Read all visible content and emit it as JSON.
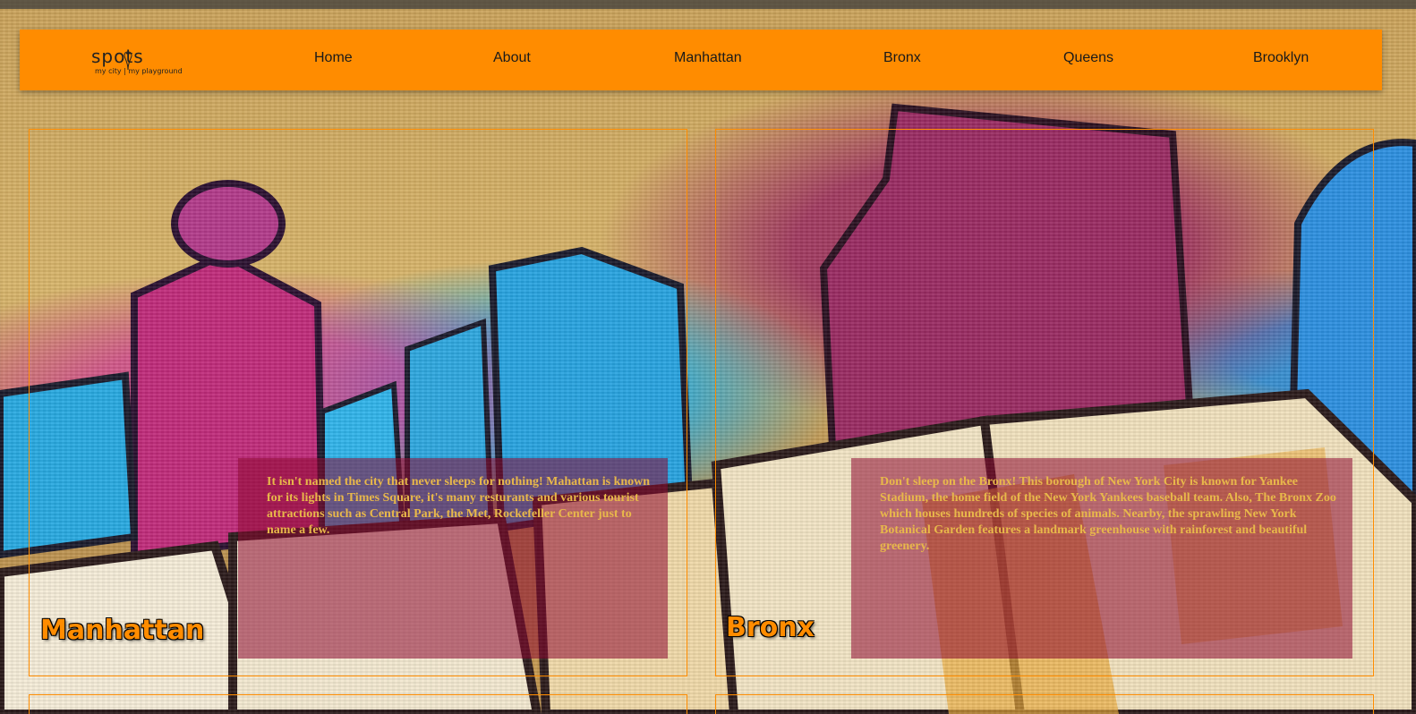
{
  "colors": {
    "accent": "#ff8c00",
    "overlay": "rgba(140, 10, 50, 0.55)",
    "desc_text": "#e8b84a"
  },
  "logo": {
    "word": "spots",
    "tagline": "my city | my playground",
    "icon": "map-pin-icon"
  },
  "nav": {
    "items": [
      {
        "label": "Home"
      },
      {
        "label": "About"
      },
      {
        "label": "Manhattan"
      },
      {
        "label": "Bronx"
      },
      {
        "label": "Queens"
      },
      {
        "label": "Brooklyn"
      }
    ]
  },
  "cards": [
    {
      "title": "Manhattan",
      "description": "It isn't named the city that never sleeps for nothing! Mahattan is known for its lights in Times Square, it's many resturants and various tourist attractions such as Central Park, the Met, Rockefeller Center just to name a few."
    },
    {
      "title": "Bronx",
      "description": "Don't sleep on the Bronx! This borough of New York City is known for Yankee Stadium, the home field of the New York Yankees baseball team. Also, The Bronx Zoo which houses hundreds of species of animals. Nearby, the sprawling New York Botanical Garden features a landmark greenhouse with rainforest and beautiful greenery."
    }
  ]
}
